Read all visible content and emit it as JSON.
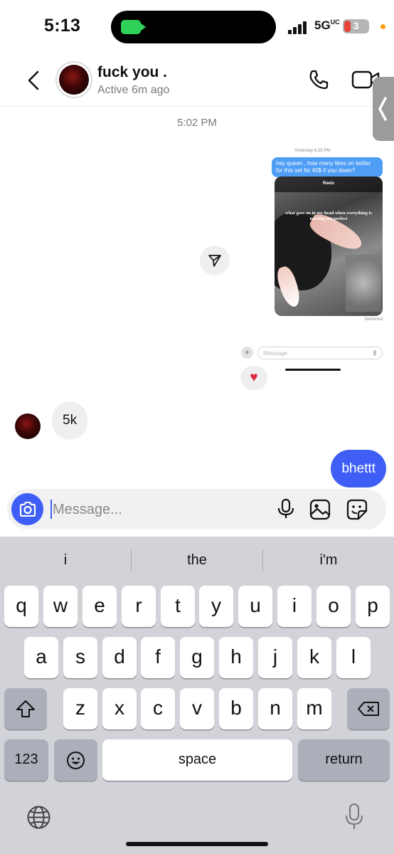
{
  "status_bar": {
    "time": "5:13",
    "network": "5G",
    "network_suffix": "UC",
    "battery": "3",
    "signal_bars": 4
  },
  "header": {
    "contact_name": "fuck you .",
    "contact_status": "Active 6m ago"
  },
  "chat": {
    "timestamp": "5:02 PM",
    "shared_screenshot": {
      "time": "Yesterday 6:25 PM",
      "message": "hey queen , how many likes on twitter for this set for 40$ if you down?",
      "reel_label": "Reels",
      "reel_caption": "what goes on in my head when everything is turning out perfect",
      "delivered": "Delivered",
      "input_placeholder": "iMessage"
    },
    "reaction": "♥",
    "incoming_message": "5k",
    "outgoing_message": "bhettt"
  },
  "composer": {
    "placeholder": "Message..."
  },
  "keyboard": {
    "suggestions": [
      "i",
      "the",
      "i'm"
    ],
    "row1": [
      "q",
      "w",
      "e",
      "r",
      "t",
      "y",
      "u",
      "i",
      "o",
      "p"
    ],
    "row2": [
      "a",
      "s",
      "d",
      "f",
      "g",
      "h",
      "j",
      "k",
      "l"
    ],
    "row3": [
      "z",
      "x",
      "c",
      "v",
      "b",
      "n",
      "m"
    ],
    "numbers_key": "123",
    "space_key": "space",
    "return_key": "return"
  },
  "colors": {
    "accent": "#3e5ef6",
    "imessage_blue": "#4f9df4",
    "keyboard_bg": "#d1d3d9",
    "heart": "#e0263c"
  }
}
